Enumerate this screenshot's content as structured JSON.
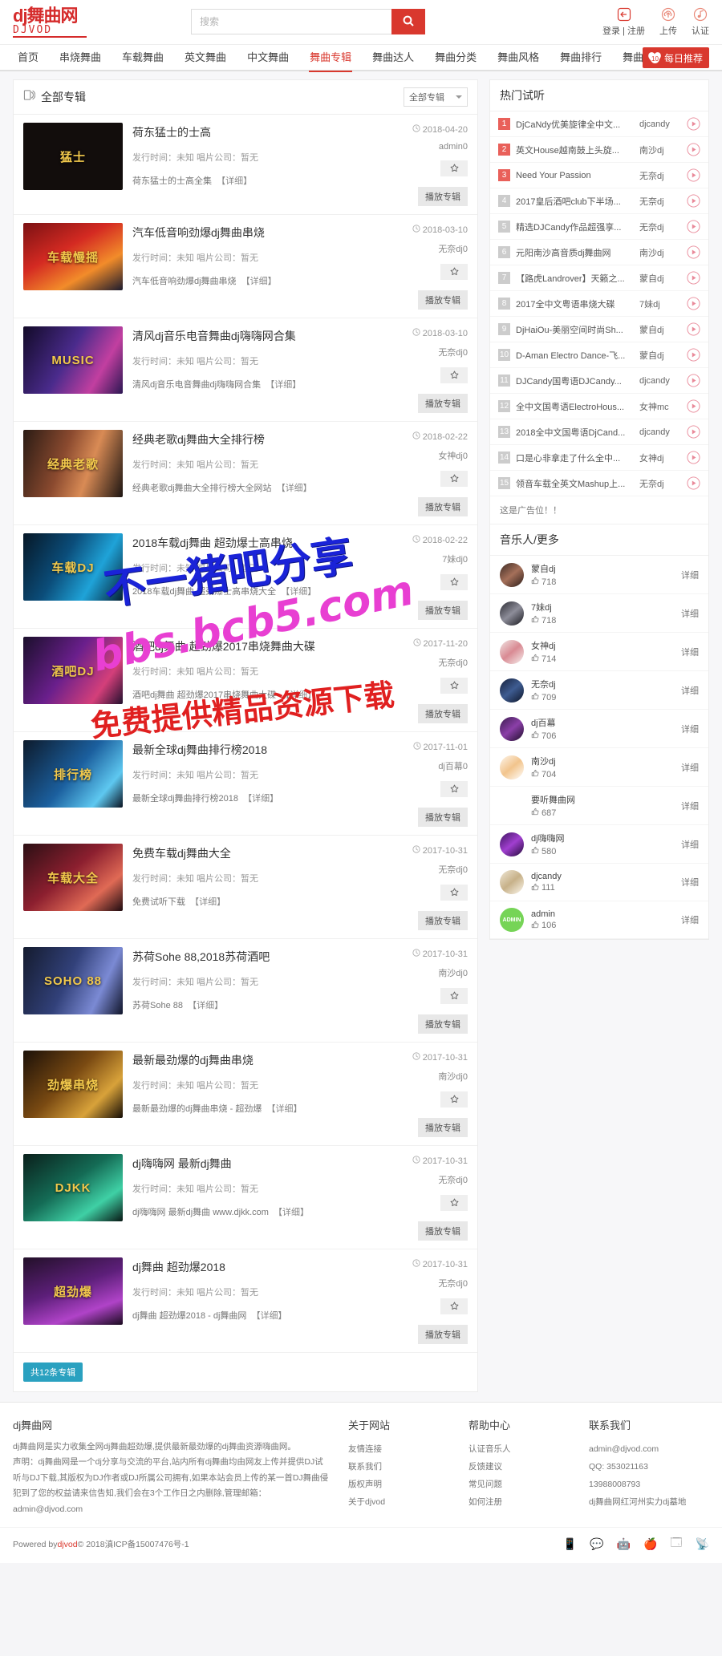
{
  "header": {
    "logo_top": "dj舞曲网",
    "logo_sub": "DJVOD",
    "search": {
      "placeholder": "搜索",
      "value": "",
      "icon": "search-icon"
    },
    "actions": [
      {
        "icon": "login-icon",
        "label": "登录 | 注册"
      },
      {
        "icon": "upload-icon",
        "label": "上传"
      },
      {
        "icon": "verify-icon",
        "label": "认证"
      }
    ]
  },
  "nav": {
    "items": [
      {
        "label": "首页",
        "active": false
      },
      {
        "label": "串烧舞曲",
        "active": false
      },
      {
        "label": "车载舞曲",
        "active": false
      },
      {
        "label": "英文舞曲",
        "active": false
      },
      {
        "label": "中文舞曲",
        "active": false
      },
      {
        "label": "舞曲专辑",
        "active": true
      },
      {
        "label": "舞曲达人",
        "active": false
      },
      {
        "label": "舞曲分类",
        "active": false
      },
      {
        "label": "舞曲风格",
        "active": false
      },
      {
        "label": "舞曲排行",
        "active": false
      },
      {
        "label": "舞曲资讯",
        "active": false
      }
    ],
    "daily": {
      "label": "每日推荐",
      "badge": "10"
    }
  },
  "albums_section": {
    "icon": "album-icon",
    "title": "全部专辑",
    "filter_label": "全部专辑",
    "meta_label": "发行时间：未知 唱片公司：暂无",
    "detail_label": "【详细】",
    "fav_icon": "star-icon",
    "play_button": "播放专辑",
    "date_icon": "clock-icon",
    "pager_label": "共12条专辑",
    "rows": [
      {
        "title": "荷东猛士的士高",
        "date": "2018-04-20",
        "author": "admin0",
        "desc": "荷东猛士的士高全集",
        "cover": "cv1",
        "cover_text": "猛士"
      },
      {
        "title": "汽车低音响劲爆dj舞曲串烧",
        "date": "2018-03-10",
        "author": "无奈dj0",
        "desc": "汽车低音响劲爆dj舞曲串烧",
        "cover": "cv2",
        "cover_text": "车载慢摇"
      },
      {
        "title": "清风dj音乐电音舞曲dj嗨嗨网合集",
        "date": "2018-03-10",
        "author": "无奈dj0",
        "desc": "清风dj音乐电音舞曲dj嗨嗨网合集",
        "cover": "cv3",
        "cover_text": "MUSIC"
      },
      {
        "title": "经典老歌dj舞曲大全排行榜",
        "date": "2018-02-22",
        "author": "女神dj0",
        "desc": "经典老歌dj舞曲大全排行榜大全网站",
        "cover": "cv4",
        "cover_text": "经典老歌"
      },
      {
        "title": "2018车载dj舞曲 超劲爆士高串烧",
        "date": "2018-02-22",
        "author": "7妹dj0",
        "desc": "2018车载dj舞曲 超劲爆士高串烧大全",
        "cover": "cv5",
        "cover_text": "车载DJ"
      },
      {
        "title": "酒吧dj舞曲 超劲爆2017串烧舞曲大碟",
        "date": "2017-11-20",
        "author": "无奈dj0",
        "desc": "酒吧dj舞曲 超劲爆2017串烧舞曲大碟",
        "cover": "cv6",
        "cover_text": "酒吧DJ"
      },
      {
        "title": "最新全球dj舞曲排行榜2018",
        "date": "2017-11-01",
        "author": "dj百幕0",
        "desc": "最新全球dj舞曲排行榜2018",
        "cover": "cv7",
        "cover_text": "排行榜"
      },
      {
        "title": "免费车载dj舞曲大全",
        "date": "2017-10-31",
        "author": "无奈dj0",
        "desc": "免费试听下载",
        "cover": "cv8",
        "cover_text": "车载大全"
      },
      {
        "title": "苏荷Sohe 88,2018苏荷酒吧",
        "date": "2017-10-31",
        "author": "南沙dj0",
        "desc": "苏荷Sohe 88",
        "cover": "cv9",
        "cover_text": "SOHO 88"
      },
      {
        "title": "最新最劲爆的dj舞曲串烧",
        "date": "2017-10-31",
        "author": "南沙dj0",
        "desc": "最新最劲爆的dj舞曲串烧 - 超劲爆",
        "cover": "cv10",
        "cover_text": "劲爆串烧"
      },
      {
        "title": "dj嗨嗨网 最新dj舞曲",
        "date": "2017-10-31",
        "author": "无奈dj0",
        "desc": "dj嗨嗨网 最新dj舞曲 www.djkk.com",
        "cover": "cv11",
        "cover_text": "DJKK"
      },
      {
        "title": "dj舞曲 超劲爆2018",
        "date": "2017-10-31",
        "author": "无奈dj0",
        "desc": "dj舞曲 超劲爆2018 - dj舞曲网",
        "cover": "cv12",
        "cover_text": "超劲爆"
      }
    ]
  },
  "sidebar": {
    "hot_title": "热门试听",
    "play_icon": "play-circle-icon",
    "hot_items": [
      {
        "rank": "1",
        "name": "DjCaNdy优美旋律全中文...",
        "dj": "djcandy"
      },
      {
        "rank": "2",
        "name": "英文House越南鼓上头旋...",
        "dj": "南沙dj"
      },
      {
        "rank": "3",
        "name": "Need Your Passion",
        "dj": "无奈dj"
      },
      {
        "rank": "4",
        "name": "2017皇后酒吧club下半场...",
        "dj": "无奈dj"
      },
      {
        "rank": "5",
        "name": "精选DJCandy作品超强享...",
        "dj": "无奈dj"
      },
      {
        "rank": "6",
        "name": "元阳南沙高音质dj舞曲网",
        "dj": "南沙dj"
      },
      {
        "rank": "7",
        "name": "【路虎Landrover】天籁之...",
        "dj": "蒙自dj"
      },
      {
        "rank": "8",
        "name": "2017全中文粤语串烧大碟",
        "dj": "7妹dj"
      },
      {
        "rank": "9",
        "name": "DjHaiOu-美丽空间时尚Sh...",
        "dj": "蒙自dj"
      },
      {
        "rank": "10",
        "name": "D-Aman Electro Dance-飞...",
        "dj": "蒙自dj"
      },
      {
        "rank": "11",
        "name": "DJCandy国粤语DJCandy...",
        "dj": "djcandy"
      },
      {
        "rank": "12",
        "name": "全中文国粤语ElectroHous...",
        "dj": "女神mc"
      },
      {
        "rank": "13",
        "name": "2018全中文国粤语DjCand...",
        "dj": "djcandy"
      },
      {
        "rank": "14",
        "name": "口是心非拿走了什么全中...",
        "dj": "女神dj"
      },
      {
        "rank": "15",
        "name": "领音车载全英文Mashup上...",
        "dj": "无奈dj"
      }
    ],
    "ad_text": "这是广告位！！",
    "musician_title": "音乐人/更多",
    "like_icon": "thumb-up-icon",
    "detail_label": "详细",
    "musicians": [
      {
        "name": "蒙自dj",
        "likes": "718",
        "avatar": "av1",
        "avatar_text": ""
      },
      {
        "name": "7妹dj",
        "likes": "718",
        "avatar": "av2",
        "avatar_text": ""
      },
      {
        "name": "女神dj",
        "likes": "714",
        "avatar": "av3",
        "avatar_text": ""
      },
      {
        "name": "无奈dj",
        "likes": "709",
        "avatar": "av4",
        "avatar_text": ""
      },
      {
        "name": "dj百幕",
        "likes": "706",
        "avatar": "av5",
        "avatar_text": ""
      },
      {
        "name": "南沙dj",
        "likes": "704",
        "avatar": "av6",
        "avatar_text": ""
      },
      {
        "name": "要听舞曲网",
        "likes": "687",
        "avatar": "av7",
        "avatar_text": "要听舞曲网"
      },
      {
        "name": "dj嗨嗨网",
        "likes": "580",
        "avatar": "av8",
        "avatar_text": ""
      },
      {
        "name": "djcandy",
        "likes": "111",
        "avatar": "av9",
        "avatar_text": ""
      },
      {
        "name": "admin",
        "likes": "106",
        "avatar": "av10",
        "avatar_text": "ADMIN"
      }
    ]
  },
  "watermarks": {
    "w1": "不一猪吧分享",
    "w2": "bbs.bcb5.com",
    "w3": "免费提供精品资源下载"
  },
  "footer": {
    "about_title": "dj舞曲网",
    "about_p1": "dj舞曲网是实力收集全网dj舞曲超劲爆,提供最新最劲爆的dj舞曲资源嗨曲网。",
    "about_p2": "声明：dj舞曲网是一个dj分享与交流的平台,站内所有dj舞曲均由网友上传并提供DJ试听与DJ下载,其版权为DJ作者或DJ所属公司拥有,如果本站会员上传的某一首DJ舞曲侵犯到了您的权益请来信告知,我们会在3个工作日之内删除,管理邮箱：admin@djvod.com",
    "cols": [
      {
        "title": "关于网站",
        "items": [
          "友情连接",
          "联系我们",
          "版权声明",
          "关于djvod"
        ]
      },
      {
        "title": "帮助中心",
        "items": [
          "认证音乐人",
          "反馈建议",
          "常见问题",
          "如何注册"
        ]
      },
      {
        "title": "联系我们",
        "items": [
          "admin@djvod.com",
          "QQ: 353021163",
          "13988008793",
          "dj舞曲网红河州实力dj墓地"
        ]
      }
    ],
    "copyright_pre": "Powered by",
    "copyright_link": "djvod",
    "copyright_post": "© 2018滇ICP备15007476号-1",
    "icons": [
      "weibo-icon",
      "wechat-icon",
      "android-icon",
      "apple-icon",
      "windows-icon",
      "rss-icon"
    ]
  },
  "colors": {
    "brand": "#d9382e",
    "accent": "#e9605a",
    "pager": "#2aa1c0"
  }
}
